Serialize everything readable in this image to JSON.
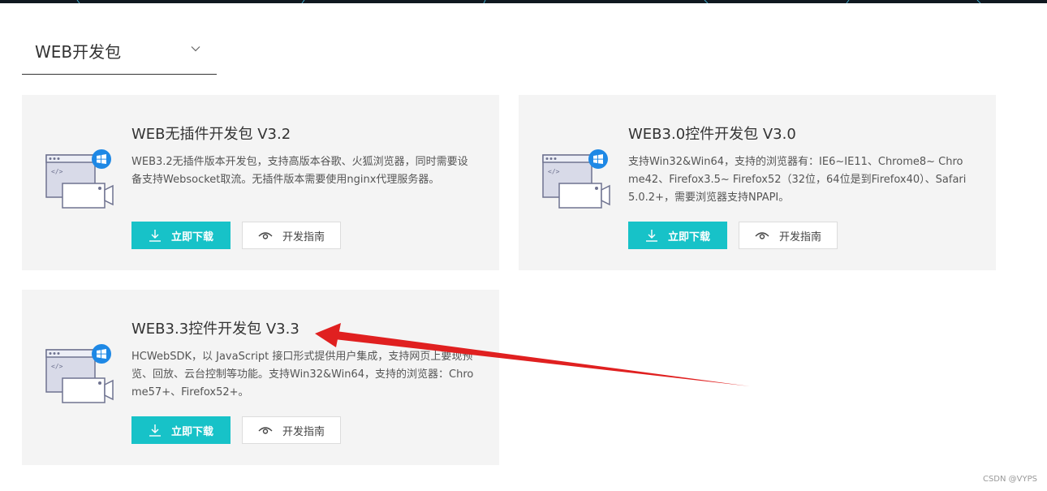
{
  "select": {
    "value": "WEB开发包",
    "icon": "chevron-down-icon"
  },
  "cards": [
    {
      "title": "WEB无插件开发包 V3.2",
      "desc": "WEB3.2无插件版本开发包，支持高版本谷歌、火狐浏览器，同时需要设备支持Websocket取流。无插件版本需要使用nginx代理服务器。",
      "download_label": "立即下载",
      "guide_label": "开发指南"
    },
    {
      "title": "WEB3.0控件开发包 V3.0",
      "desc": "支持Win32&Win64，支持的浏览器有：IE6~IE11、Chrome8~ Chrome42、Firefox3.5~ Firefox52（32位，64位是到Firefox40）、Safari5.0.2+，需要浏览器支持NPAPI。",
      "download_label": "立即下载",
      "guide_label": "开发指南"
    },
    {
      "title": "WEB3.3控件开发包 V3.3",
      "desc": "HCWebSDK，以 JavaScript 接口形式提供用户集成，支持网页上要现预览、回放、云台控制等功能。支持Win32&Win64，支持的浏览器：Chrome57+、Firefox52+。",
      "download_label": "立即下载",
      "guide_label": "开发指南"
    }
  ],
  "illustration": {
    "code_glyph": "</>"
  },
  "watermark": "CSDN @VYPS",
  "colors": {
    "accent": "#17c2c8",
    "card_bg": "#f4f4f4",
    "annotation_arrow": "#e02020",
    "windows_badge": "#1e88e5"
  }
}
